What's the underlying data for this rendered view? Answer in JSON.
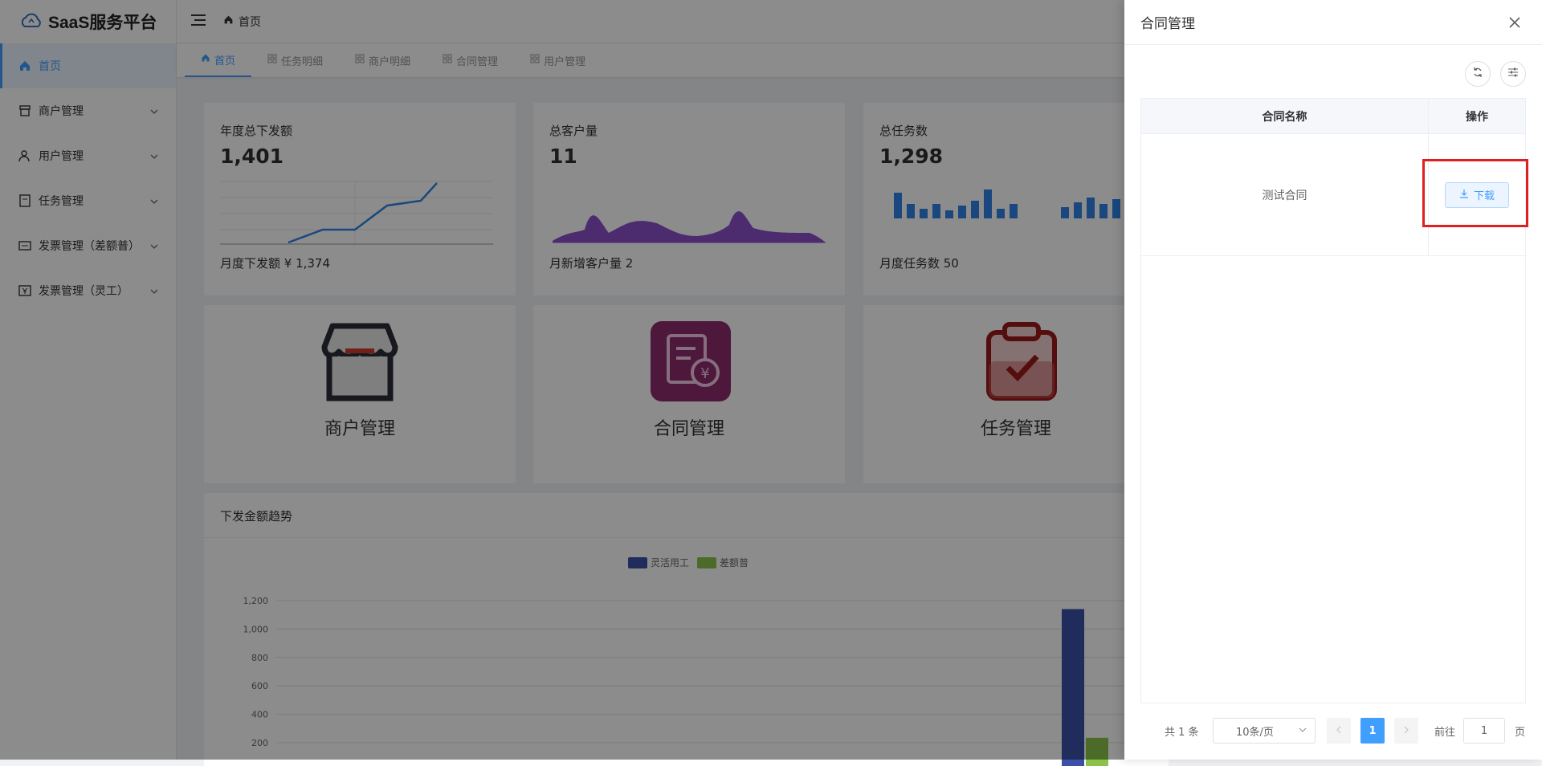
{
  "app": {
    "title": "SaaS服务平台"
  },
  "sidebar": {
    "items": [
      {
        "label": "首页"
      },
      {
        "label": "商户管理"
      },
      {
        "label": "用户管理"
      },
      {
        "label": "任务管理"
      },
      {
        "label": "发票管理（差额普）"
      },
      {
        "label": "发票管理（灵工）"
      }
    ]
  },
  "header": {
    "breadcrumb": "首页"
  },
  "tabs": [
    {
      "label": "首页"
    },
    {
      "label": "任务明细"
    },
    {
      "label": "商户明细"
    },
    {
      "label": "合同管理"
    },
    {
      "label": "用户管理"
    }
  ],
  "stats": [
    {
      "label": "年度总下发额",
      "value": "1,401",
      "footer": "月度下发额 ¥ 1,374"
    },
    {
      "label": "总客户量",
      "value": "11",
      "footer": "月新增客户量 2"
    },
    {
      "label": "总任务数",
      "value": "1,298",
      "footer": "月度任务数 50"
    }
  ],
  "quick": [
    {
      "label": "商户管理"
    },
    {
      "label": "合同管理"
    },
    {
      "label": "任务管理"
    }
  ],
  "trend": {
    "title": "下发金额趋势",
    "legend": [
      "灵活用工",
      "差额普"
    ],
    "yticks": [
      "1,200",
      "1,000",
      "800",
      "600",
      "400",
      "200"
    ]
  },
  "chart_data": {
    "type": "bar",
    "title": "下发金额趋势",
    "series": [
      {
        "name": "灵活用工",
        "values": [
          1140
        ]
      },
      {
        "name": "差额普",
        "values": [
          235
        ]
      }
    ],
    "ylim": [
      0,
      1200
    ],
    "legend_position": "top"
  },
  "drawer": {
    "title": "合同管理",
    "columns": [
      "合同名称",
      "操作"
    ],
    "rows": [
      {
        "name": "测试合同",
        "action": "下载"
      }
    ],
    "pagination": {
      "total": "共 1 条",
      "page_size": "10条/页",
      "current": "1",
      "goto_label": "前往",
      "goto_value": "1",
      "page_suffix": "页"
    }
  },
  "colors": {
    "accent": "#409eff",
    "highlight": "#e02020",
    "purple": "#8b4fc8",
    "bar_blue": "#2f82e6"
  }
}
